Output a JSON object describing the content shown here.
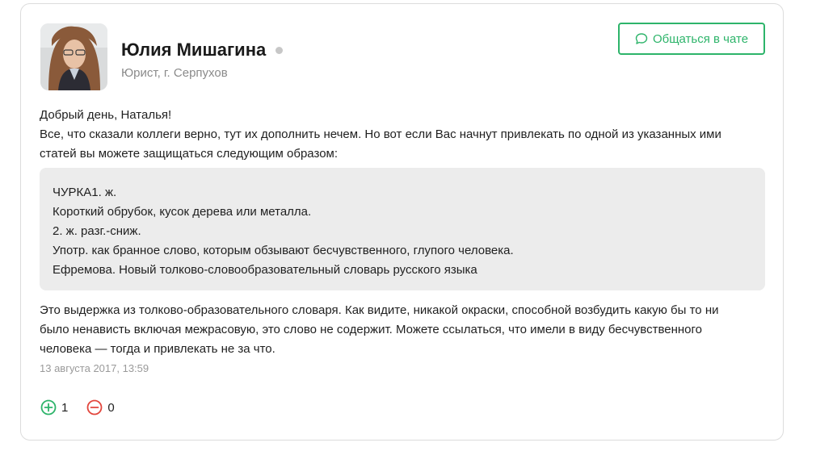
{
  "author": {
    "name": "Юлия Мишагина",
    "role": "Юрист, г. Серпухов",
    "status_color": "#c7c7c7"
  },
  "chat_button": {
    "label": "Общаться в чате",
    "icon": "chat-bubble-icon",
    "color": "#2db46a"
  },
  "message": {
    "intro_lines": [
      "Добрый день, Наталья!",
      "Все, что сказали коллеги верно, тут их дополнить нечем. Но вот если Вас начнут привлекать по одной из указанных ими",
      "статей вы можете защищаться следующим образом:"
    ],
    "quote_lines": [
      "ЧУРКА1. ж.",
      "Короткий обрубок, кусок дерева или металла.",
      "2. ж. разг.-сниж.",
      "Употр. как бранное слово, которым обзывают бесчувственного, глупого человека.",
      "Ефремова. Новый толково-словообразовательный словарь русского языка"
    ],
    "outro_lines": [
      "Это выдержка из толково-образовательного словаря. Как видите, никакой окраски, способной возбудить какую бы то ни",
      "было ненависть включая межрасовую, это слово не содержит. Можете ссылаться, что имели в виду бесчувственного",
      "человека — тогда и привлекать не за что."
    ],
    "date": "13 августа 2017, 13:59"
  },
  "votes": {
    "up_count": "1",
    "down_count": "0",
    "up_color": "#2db46a",
    "down_color": "#e2453c"
  }
}
